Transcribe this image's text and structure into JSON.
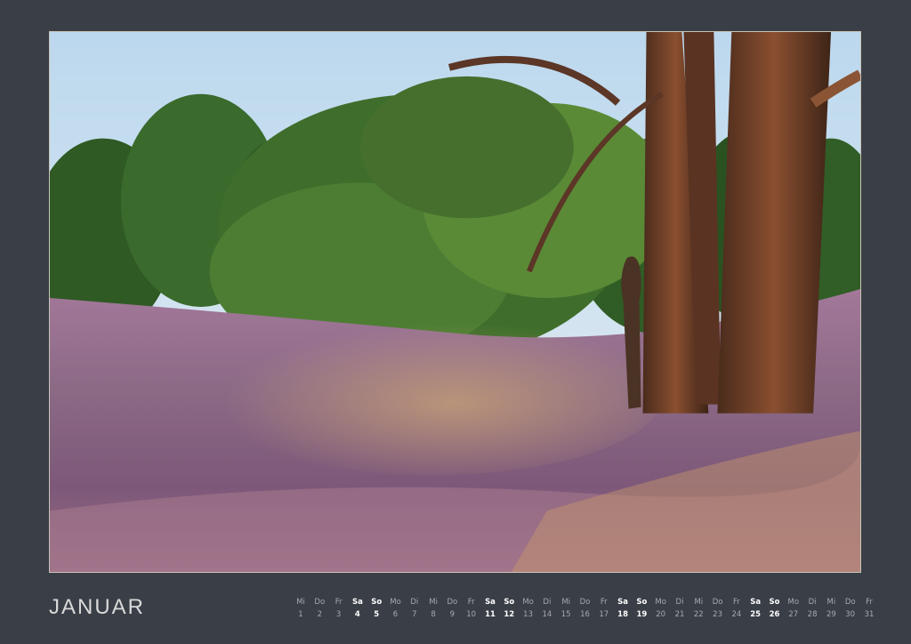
{
  "calendar": {
    "month": "JANUAR",
    "days": [
      {
        "wd": "Mi",
        "d": "1"
      },
      {
        "wd": "Do",
        "d": "2"
      },
      {
        "wd": "Fr",
        "d": "3"
      },
      {
        "wd": "Sa",
        "d": "4",
        "we": true
      },
      {
        "wd": "So",
        "d": "5",
        "we": true
      },
      {
        "wd": "Mo",
        "d": "6"
      },
      {
        "wd": "Di",
        "d": "7"
      },
      {
        "wd": "Mi",
        "d": "8"
      },
      {
        "wd": "Do",
        "d": "9"
      },
      {
        "wd": "Fr",
        "d": "10"
      },
      {
        "wd": "Sa",
        "d": "11",
        "we": true
      },
      {
        "wd": "So",
        "d": "12",
        "we": true
      },
      {
        "wd": "Mo",
        "d": "13"
      },
      {
        "wd": "Di",
        "d": "14"
      },
      {
        "wd": "Mi",
        "d": "15"
      },
      {
        "wd": "Do",
        "d": "16"
      },
      {
        "wd": "Fr",
        "d": "17"
      },
      {
        "wd": "Sa",
        "d": "18",
        "we": true
      },
      {
        "wd": "So",
        "d": "19",
        "we": true
      },
      {
        "wd": "Mo",
        "d": "20"
      },
      {
        "wd": "Di",
        "d": "21"
      },
      {
        "wd": "Mi",
        "d": "22"
      },
      {
        "wd": "Do",
        "d": "23"
      },
      {
        "wd": "Fr",
        "d": "24"
      },
      {
        "wd": "Sa",
        "d": "25",
        "we": true
      },
      {
        "wd": "So",
        "d": "26",
        "we": true
      },
      {
        "wd": "Mo",
        "d": "27"
      },
      {
        "wd": "Di",
        "d": "28"
      },
      {
        "wd": "Mi",
        "d": "29"
      },
      {
        "wd": "Do",
        "d": "30"
      },
      {
        "wd": "Fr",
        "d": "31"
      }
    ]
  },
  "colors": {
    "background": "#3a3f47",
    "sky": "#cfe2f0",
    "heather": "#8a5f8a",
    "grass": "#c9a25a",
    "foliage": "#3f6b2a",
    "bark": "#6b3f28"
  }
}
